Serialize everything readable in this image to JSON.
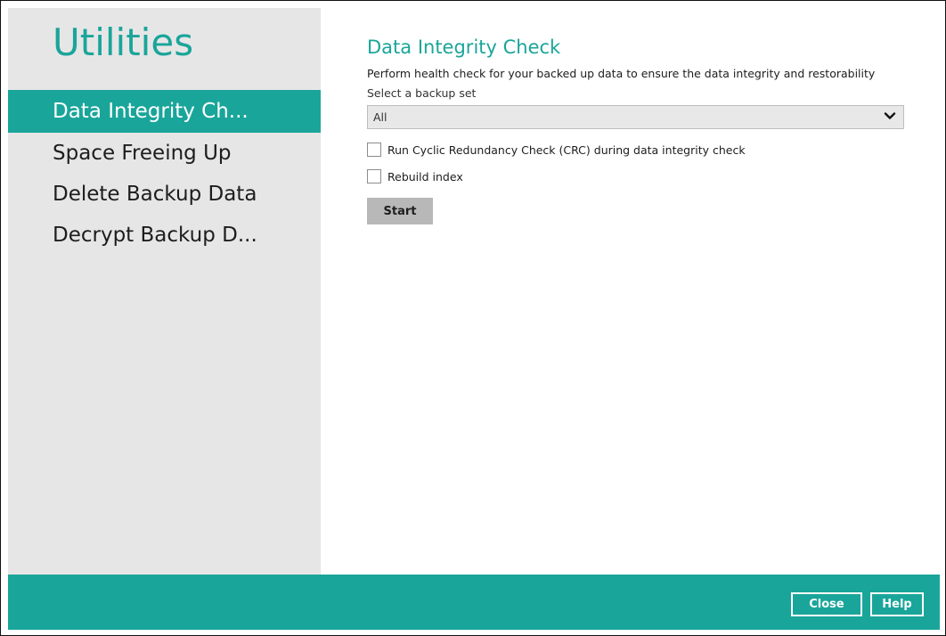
{
  "sidebar": {
    "title": "Utilities",
    "items": [
      {
        "label": "Data Integrity Ch...",
        "active": true
      },
      {
        "label": "Space Freeing Up",
        "active": false
      },
      {
        "label": "Delete Backup Data",
        "active": false
      },
      {
        "label": "Decrypt Backup D...",
        "active": false
      }
    ]
  },
  "main": {
    "title": "Data Integrity Check",
    "description": "Perform health check for your backed up data to ensure the data integrity and restorability",
    "backup_set_label": "Select a backup set",
    "backup_set_value": "All",
    "options": [
      {
        "label": "Run Cyclic Redundancy Check (CRC) during data integrity check",
        "checked": false
      },
      {
        "label": "Rebuild index",
        "checked": false
      }
    ],
    "start_label": "Start"
  },
  "footer": {
    "close_label": "Close",
    "help_label": "Help"
  },
  "colors": {
    "accent": "#1aa59a",
    "sidebar_bg": "#e6e6e6",
    "button_bg": "#b8b8b8"
  },
  "icons": {
    "dropdown": "chevron-down-icon"
  }
}
